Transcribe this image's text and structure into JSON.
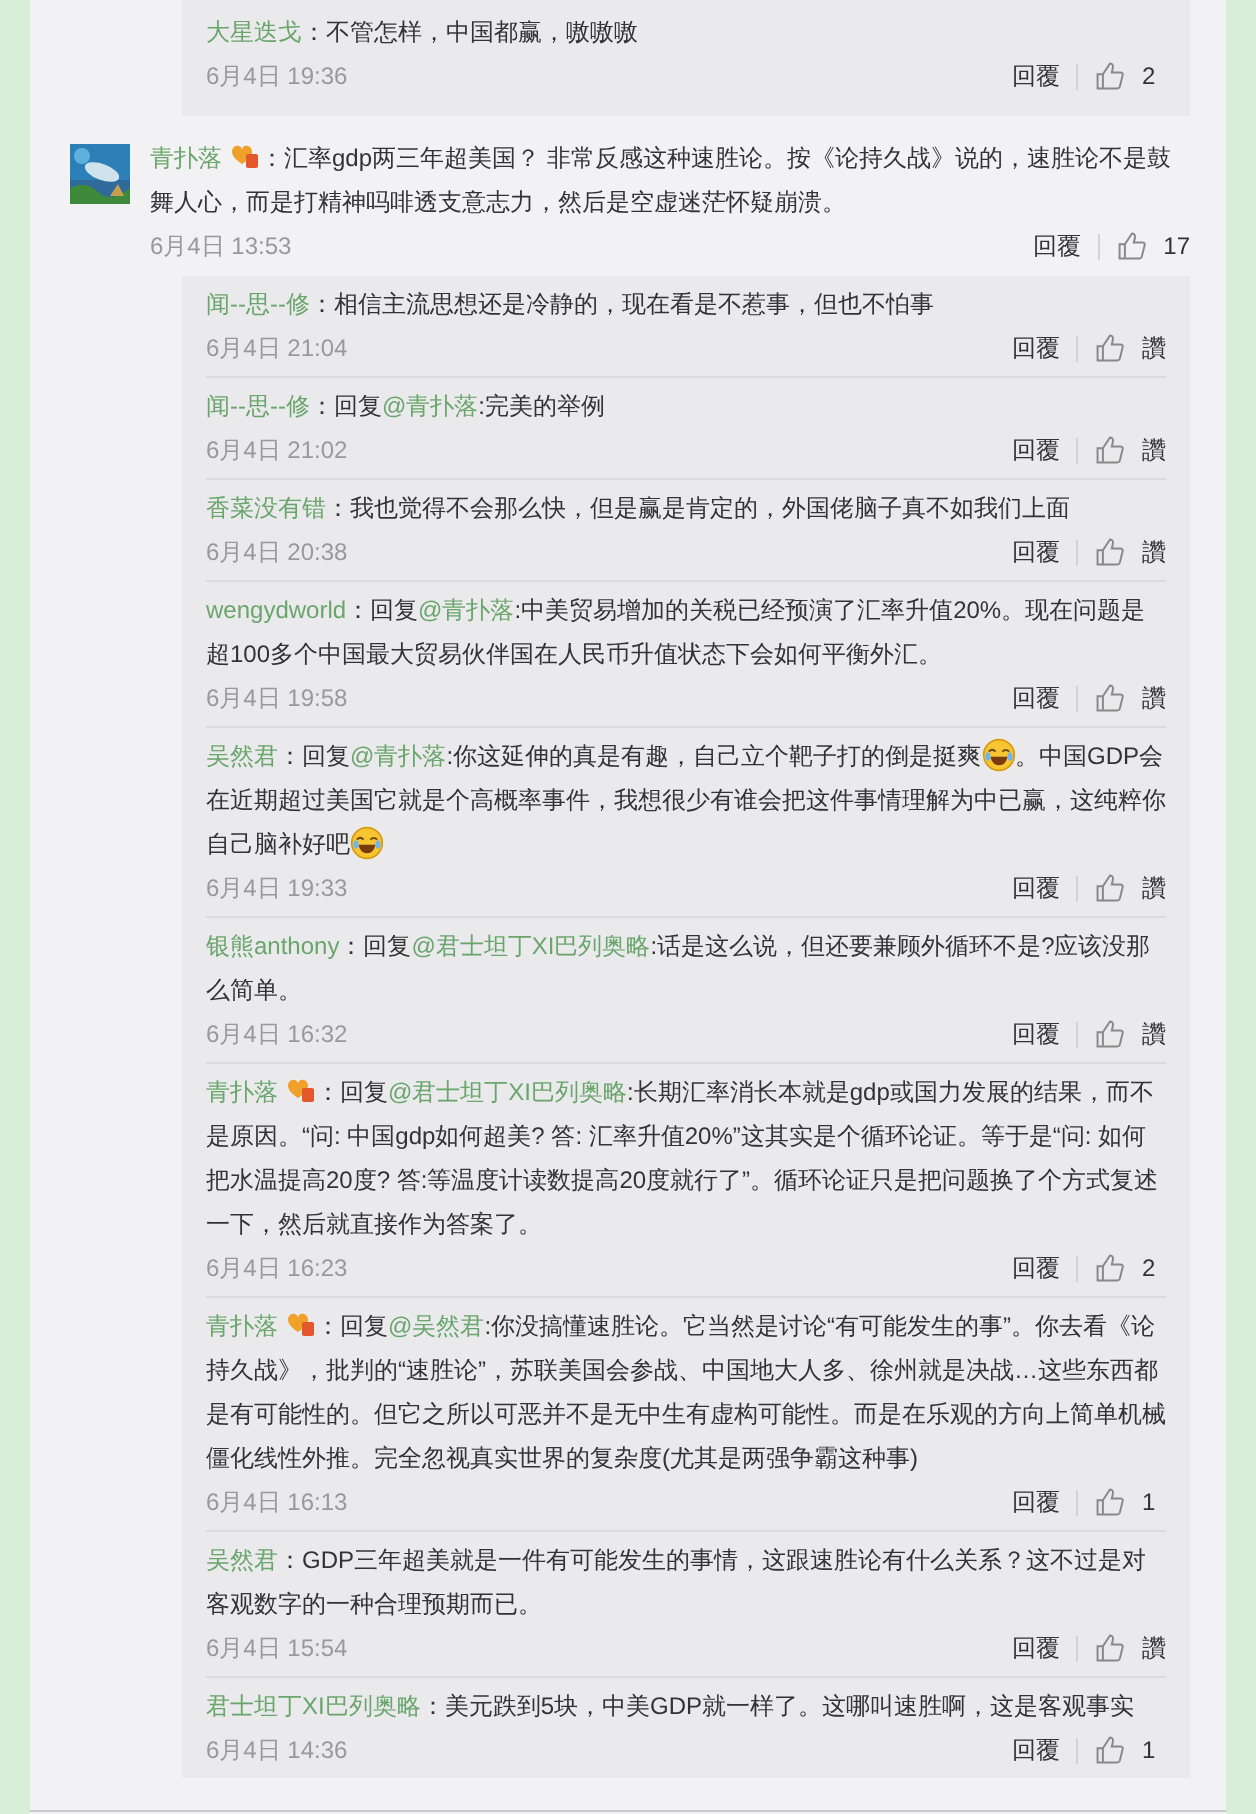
{
  "previous_thread": {
    "replies": [
      {
        "user": "大星迭戈",
        "badge": false,
        "body": [
          {
            "kind": "text",
            "text": "：不管怎样，中国都赢，嗷嗷嗷"
          }
        ],
        "date": "6月4日 19:36",
        "reply_label": "回覆",
        "likes": "2"
      }
    ]
  },
  "comment": {
    "user": "青扑落",
    "badge": true,
    "body": [
      {
        "kind": "text",
        "text": "：汇率gdp两三年超美国？ 非常反感这种速胜论。按《论持久战》说的，速胜论不是鼓舞人心，而是打精神吗啡透支意志力，然后是空虚迷茫怀疑崩溃。"
      }
    ],
    "date": "6月4日 13:53",
    "reply_label": "回覆",
    "likes": "17",
    "replies": [
      {
        "user": "闻--思--修",
        "badge": false,
        "body": [
          {
            "kind": "text",
            "text": "：相信主流思想还是冷静的，现在看是不惹事，但也不怕事"
          }
        ],
        "date": "6月4日 21:04",
        "reply_label": "回覆",
        "likes": "讚"
      },
      {
        "user": "闻--思--修",
        "badge": false,
        "body": [
          {
            "kind": "text",
            "text": "：回复"
          },
          {
            "kind": "mention",
            "text": "@青扑落"
          },
          {
            "kind": "text",
            "text": ":完美的举例"
          }
        ],
        "date": "6月4日 21:02",
        "reply_label": "回覆",
        "likes": "讚"
      },
      {
        "user": "香菜没有错",
        "badge": false,
        "body": [
          {
            "kind": "text",
            "text": "：我也觉得不会那么快，但是赢是肯定的，外国佬脑子真不如我们上面"
          }
        ],
        "date": "6月4日 20:38",
        "reply_label": "回覆",
        "likes": "讚"
      },
      {
        "user": "wengydworld",
        "badge": false,
        "body": [
          {
            "kind": "text",
            "text": "：回复"
          },
          {
            "kind": "mention",
            "text": "@青扑落"
          },
          {
            "kind": "text",
            "text": ":中美贸易增加的关税已经预演了汇率升值20%。现在问题是超100多个中国最大贸易伙伴国在人民币升值状态下会如何平衡外汇。"
          }
        ],
        "date": "6月4日 19:58",
        "reply_label": "回覆",
        "likes": "讚"
      },
      {
        "user": "吴然君",
        "badge": false,
        "body": [
          {
            "kind": "text",
            "text": "：回复"
          },
          {
            "kind": "mention",
            "text": "@青扑落"
          },
          {
            "kind": "text",
            "text": ":你这延伸的真是有趣，自己立个靶子打的倒是挺爽"
          },
          {
            "kind": "emoji"
          },
          {
            "kind": "text",
            "text": "。中国GDP会在近期超过美国它就是个高概率事件，我想很少有谁会把这件事情理解为中已赢，这纯粹你自己脑补好吧"
          },
          {
            "kind": "emoji"
          }
        ],
        "date": "6月4日 19:33",
        "reply_label": "回覆",
        "likes": "讚"
      },
      {
        "user": "银熊anthony",
        "badge": false,
        "body": [
          {
            "kind": "text",
            "text": "：回复"
          },
          {
            "kind": "mention",
            "text": "@君士坦丁XI巴列奥略"
          },
          {
            "kind": "text",
            "text": ":话是这么说，但还要兼顾外循环不是?应该没那么简单。"
          }
        ],
        "date": "6月4日 16:32",
        "reply_label": "回覆",
        "likes": "讚"
      },
      {
        "user": "青扑落",
        "badge": true,
        "body": [
          {
            "kind": "text",
            "text": "：回复"
          },
          {
            "kind": "mention",
            "text": "@君士坦丁XI巴列奥略"
          },
          {
            "kind": "text",
            "text": ":长期汇率消长本就是gdp或国力发展的结果，而不是原因。“问: 中国gdp如何超美? 答: 汇率升值20%”这其实是个循环论证。等于是“问: 如何把水温提高20度? 答:等温度计读数提高20度就行了”。循环论证只是把问题换了个方式复述一下，然后就直接作为答案了。"
          }
        ],
        "date": "6月4日 16:23",
        "reply_label": "回覆",
        "likes": "2"
      },
      {
        "user": "青扑落",
        "badge": true,
        "body": [
          {
            "kind": "text",
            "text": "：回复"
          },
          {
            "kind": "mention",
            "text": "@吴然君"
          },
          {
            "kind": "text",
            "text": ":你没搞懂速胜论。它当然是讨论“有可能发生的事”。你去看《论持久战》，批判的“速胜论”，苏联美国会参战、中国地大人多、徐州就是决战…这些东西都是有可能性的。但它之所以可恶并不是无中生有虚构可能性。而是在乐观的方向上简单机械僵化线性外推。完全忽视真实世界的复杂度(尤其是两强争霸这种事)"
          }
        ],
        "date": "6月4日 16:13",
        "reply_label": "回覆",
        "likes": "1"
      },
      {
        "user": "吴然君",
        "badge": false,
        "body": [
          {
            "kind": "text",
            "text": "：GDP三年超美就是一件有可能发生的事情，这跟速胜论有什么关系？这不过是对客观数字的一种合理预期而已。"
          }
        ],
        "date": "6月4日 15:54",
        "reply_label": "回覆",
        "likes": "讚"
      },
      {
        "user": "君士坦丁XI巴列奥略",
        "badge": false,
        "body": [
          {
            "kind": "text",
            "text": "：美元跌到5块，中美GDP就一样了。这哪叫速胜啊，这是客观事实"
          }
        ],
        "date": "6月4日 14:36",
        "reply_label": "回覆",
        "likes": "1"
      }
    ]
  }
}
